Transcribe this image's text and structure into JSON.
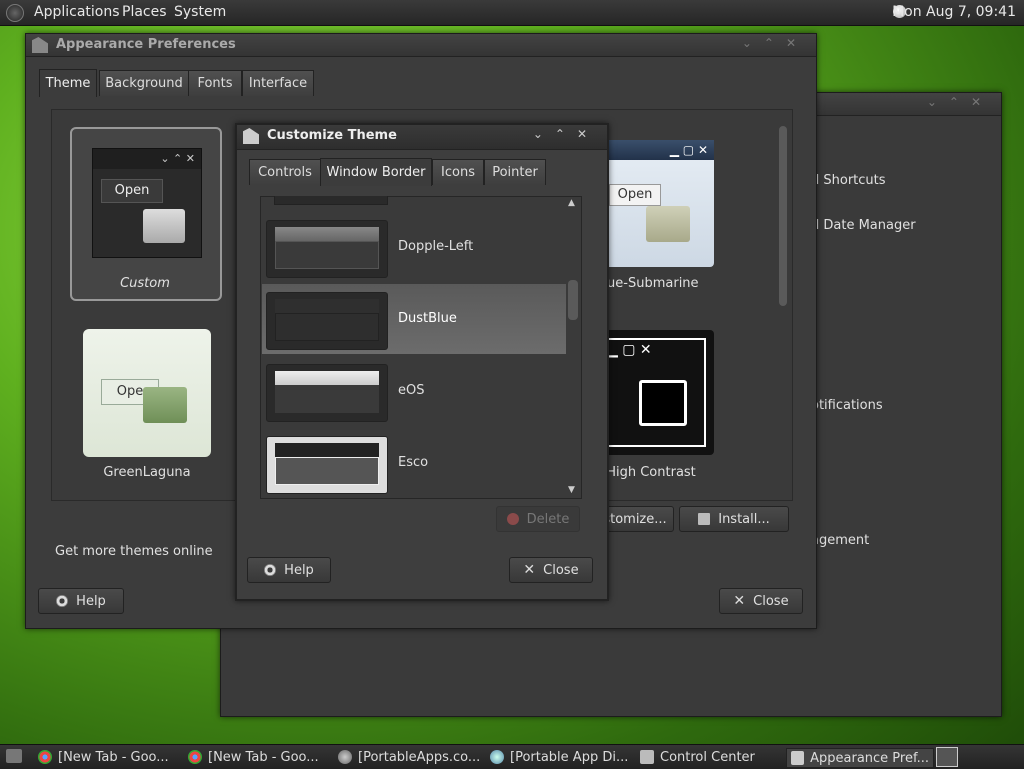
{
  "panel": {
    "menus": [
      "Applications",
      "Places",
      "System"
    ],
    "clock": "Mon Aug  7, 09:41"
  },
  "bg_window": {
    "items": [
      "d Shortcuts",
      "d Date Manager",
      "otifications",
      "agement"
    ]
  },
  "appearance": {
    "title": "Appearance Preferences",
    "tabs": [
      "Theme",
      "Background",
      "Fonts",
      "Interface"
    ],
    "themes": [
      {
        "name": "Custom",
        "preview_label": "Open"
      },
      {
        "name": "lue-Submarine",
        "preview_label": "Open"
      },
      {
        "name": "GreenLaguna",
        "preview_label": "Ope"
      },
      {
        "name": "High Contrast"
      }
    ],
    "get_more": "Get more themes online",
    "customize_label": "stomize...",
    "install_label": "Install...",
    "help_label": "Help",
    "close_label": "Close"
  },
  "customize": {
    "title": "Customize Theme",
    "tabs": [
      "Controls",
      "Window Border",
      "Icons",
      "Pointer"
    ],
    "list": [
      "Dopple-Left",
      "DustBlue",
      "eOS",
      "Esco"
    ],
    "selected": "DustBlue",
    "delete_label": "Delete",
    "help_label": "Help",
    "close_label": "Close"
  },
  "taskbar": {
    "items": [
      {
        "label": "[New Tab - Goo...",
        "icon": "chrome-icon"
      },
      {
        "label": "[New Tab - Goo...",
        "icon": "chrome-icon"
      },
      {
        "label": "[PortableApps.co...",
        "icon": "globe-icon"
      },
      {
        "label": "[Portable App Di...",
        "icon": "globe-icon"
      },
      {
        "label": "Control Center",
        "icon": "control-center-icon"
      },
      {
        "label": "Appearance Pref...",
        "icon": "appearance-icon"
      }
    ]
  },
  "colors": {
    "selection": "#6a6a6a",
    "window_bg": "#3c3c3c",
    "desktop": "#5fb01f"
  }
}
